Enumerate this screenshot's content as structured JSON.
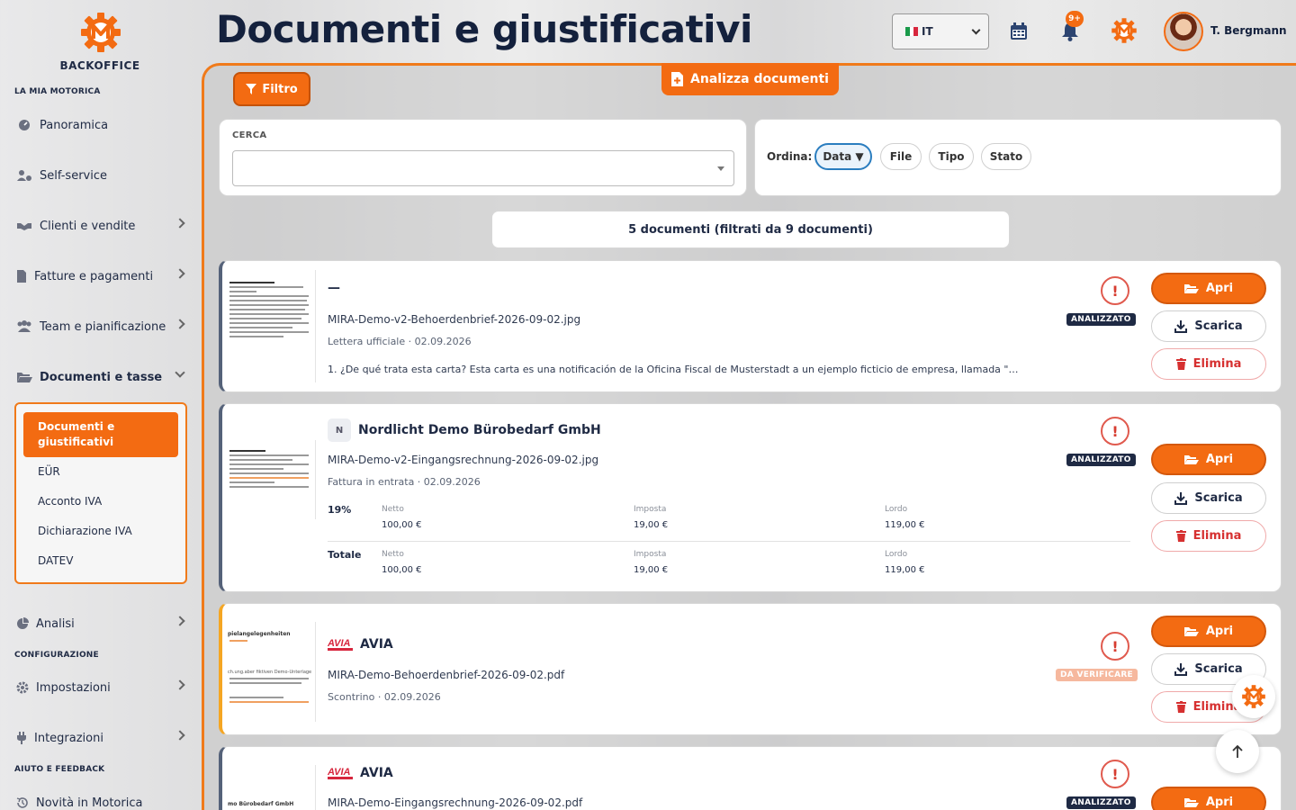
{
  "brand": {
    "logo_text": "BACKOFFICE",
    "accent": "#f36b12",
    "navy": "#14213d"
  },
  "sidebar": {
    "sections": {
      "mine": "LA MIA MOTORICA",
      "config": "CONFIGURAZIONE",
      "help": "AIUTO E FEEDBACK"
    },
    "items": [
      {
        "label": "Panoramica",
        "icon": "dashboard-icon"
      },
      {
        "label": "Self-service",
        "icon": "users-cog-icon"
      },
      {
        "label": "Clienti e vendite",
        "icon": "handshake-icon"
      },
      {
        "label": "Fatture e pagamenti",
        "icon": "invoice-icon"
      },
      {
        "label": "Team e pianificazione",
        "icon": "team-icon"
      },
      {
        "label": "Documenti e tasse",
        "icon": "folder-open-icon"
      },
      {
        "label": "Analisi",
        "icon": "pie-chart-icon"
      },
      {
        "label": "Impostazioni",
        "icon": "gear-icon"
      },
      {
        "label": "Integrazioni",
        "icon": "plug-icon"
      },
      {
        "label": "Novità in Motorica",
        "icon": "history-icon"
      }
    ],
    "submenu": {
      "active": "Documenti e giustificativi",
      "items": [
        "EÜR",
        "Acconto IVA",
        "Dichiarazione IVA",
        "DATEV"
      ]
    }
  },
  "header": {
    "title": "Documenti e giustificativi",
    "language": "IT",
    "notifications_badge": "9+",
    "user_name": "T. Bergmann"
  },
  "toolbar": {
    "filter_label": "Filtro",
    "analyze_label": "Analizza documenti",
    "search_label": "CERCA",
    "search_value": "",
    "sort_label": "Ordina:",
    "sort_options": [
      "Data ▼",
      "File",
      "Tipo",
      "Stato"
    ],
    "count_text": "5 documenti (filtrati da 9 documenti)"
  },
  "actions": {
    "open": "Apri",
    "download": "Scarica",
    "delete": "Elimina"
  },
  "documents": [
    {
      "title": "—",
      "file": "MIRA-Demo-v2-Behoerdenbrief-2026-09-02.jpg",
      "meta": "Lettera ufficiale · 02.09.2026",
      "status": "ANALIZZATO",
      "description": "1. ¿De qué trata esta carta? Esta carta es una notificación de la Oficina Fiscal de Musterstadt a un ejemplo ficticio de empresa, llamada \"…"
    },
    {
      "title": "Nordlicht Demo Bürobedarf GmbH",
      "initial": "N",
      "file": "MIRA-Demo-v2-Eingangsrechnung-2026-09-02.jpg",
      "meta": "Fattura in entrata · 02.09.2026",
      "status": "ANALIZZATO",
      "tax": {
        "captions": {
          "net": "Netto",
          "tax": "Imposta",
          "gross": "Lordo"
        },
        "rows": [
          {
            "label": "19%",
            "net": "100,00 €",
            "tax": "19,00 €",
            "gross": "119,00 €"
          },
          {
            "label": "Totale",
            "net": "100,00 €",
            "tax": "19,00 €",
            "gross": "119,00 €"
          }
        ]
      }
    },
    {
      "title": "AVIA",
      "file": "MIRA-Demo-Behoerdenbrief-2026-09-02.pdf",
      "meta": "Scontrino · 02.09.2026",
      "status": "DA VERIFICARE",
      "thumb_heading": "pielangelegenheiten",
      "thumb_line": "ch.ung.aber fiktiven Demo-Unterlage"
    },
    {
      "title": "AVIA",
      "file": "MIRA-Demo-Eingangsrechnung-2026-09-02.pdf",
      "status": "ANALIZZATO",
      "thumb_heading": "mo Bürobedarf GmbH"
    }
  ]
}
